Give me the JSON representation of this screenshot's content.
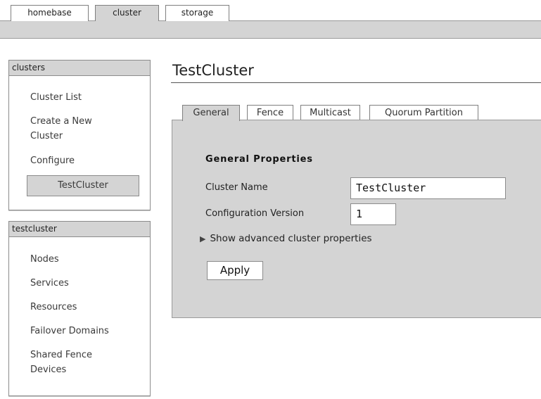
{
  "top_tabs": [
    {
      "label": "homebase"
    },
    {
      "label": "cluster"
    },
    {
      "label": "storage"
    }
  ],
  "sidebar": {
    "clusters": {
      "header": "clusters",
      "items": [
        {
          "label": "Cluster List"
        },
        {
          "label": "Create a New Cluster"
        },
        {
          "label": "Configure"
        },
        {
          "label": "TestCluster"
        }
      ]
    },
    "cluster": {
      "header": "testcluster",
      "items": [
        {
          "label": "Nodes"
        },
        {
          "label": "Services"
        },
        {
          "label": "Resources"
        },
        {
          "label": "Failover Domains"
        },
        {
          "label": "Shared Fence Devices"
        }
      ]
    }
  },
  "main": {
    "title": "TestCluster",
    "tabs": [
      {
        "label": "General"
      },
      {
        "label": "Fence"
      },
      {
        "label": "Multicast"
      },
      {
        "label": "Quorum Partition"
      }
    ],
    "section_title": "General Properties",
    "fields": {
      "cluster_name": {
        "label": "Cluster Name",
        "value": "TestCluster"
      },
      "config_version": {
        "label": "Configuration Version",
        "value": "1"
      }
    },
    "advanced_link": "Show advanced cluster properties",
    "apply_label": "Apply"
  }
}
